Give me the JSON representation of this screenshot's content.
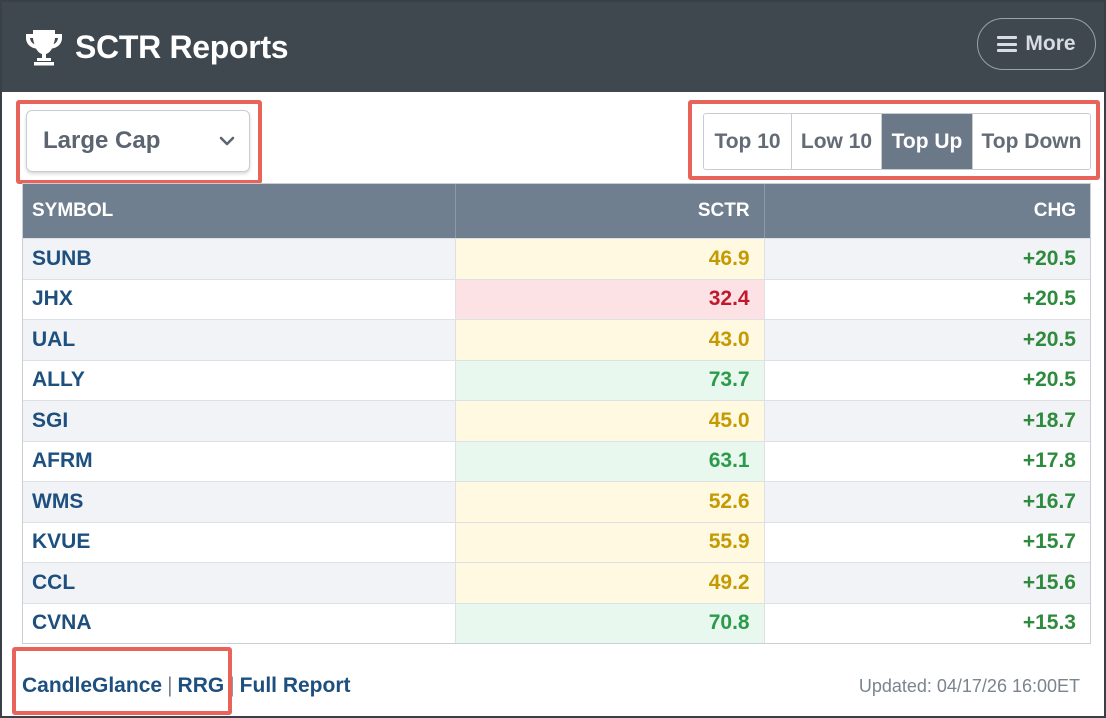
{
  "header": {
    "title": "SCTR Reports",
    "more_label": "More"
  },
  "filter": {
    "selected": "Large Cap"
  },
  "segments": {
    "items": [
      {
        "label": "Top 10",
        "active": false
      },
      {
        "label": "Low 10",
        "active": false
      },
      {
        "label": "Top Up",
        "active": true
      },
      {
        "label": "Top Down",
        "active": false
      }
    ]
  },
  "table": {
    "columns": [
      "SYMBOL",
      "SCTR",
      "CHG"
    ],
    "rows": [
      {
        "symbol": "SUNB",
        "sctr": "46.9",
        "sctr_level": "yellow",
        "chg": "+20.5"
      },
      {
        "symbol": "JHX",
        "sctr": "32.4",
        "sctr_level": "red",
        "chg": "+20.5"
      },
      {
        "symbol": "UAL",
        "sctr": "43.0",
        "sctr_level": "yellow",
        "chg": "+20.5"
      },
      {
        "symbol": "ALLY",
        "sctr": "73.7",
        "sctr_level": "green",
        "chg": "+20.5"
      },
      {
        "symbol": "SGI",
        "sctr": "45.0",
        "sctr_level": "yellow",
        "chg": "+18.7"
      },
      {
        "symbol": "AFRM",
        "sctr": "63.1",
        "sctr_level": "green",
        "chg": "+17.8"
      },
      {
        "symbol": "WMS",
        "sctr": "52.6",
        "sctr_level": "yellow",
        "chg": "+16.7"
      },
      {
        "symbol": "KVUE",
        "sctr": "55.9",
        "sctr_level": "yellow",
        "chg": "+15.7"
      },
      {
        "symbol": "CCL",
        "sctr": "49.2",
        "sctr_level": "yellow",
        "chg": "+15.6"
      },
      {
        "symbol": "CVNA",
        "sctr": "70.8",
        "sctr_level": "green",
        "chg": "+15.3"
      }
    ]
  },
  "footer": {
    "links": [
      "CandleGlance",
      "RRG",
      "Full Report"
    ],
    "separator": "|",
    "updated": "Updated: 04/17/26 16:00ET"
  },
  "colors": {
    "header_bg": "#3f474f",
    "table_header_bg": "#6f7f8f",
    "active_segment_bg": "#6b7887",
    "link": "#1d4f7f",
    "positive_change": "#2e8b3e",
    "annotation_red": "#e8645a"
  }
}
